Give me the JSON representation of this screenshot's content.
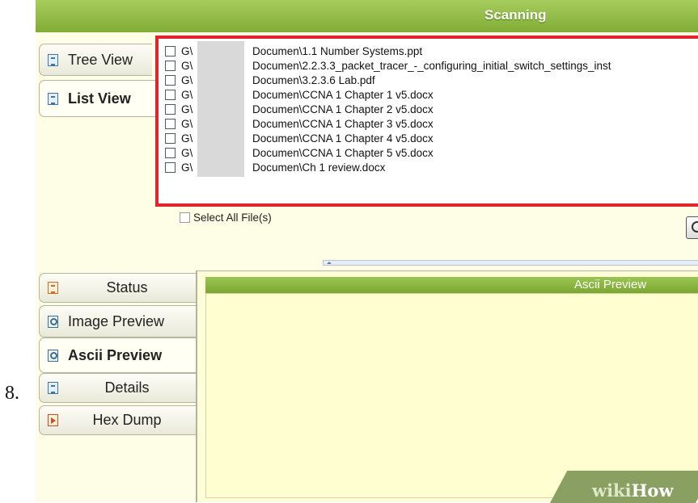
{
  "step_number": "8.",
  "header": {
    "title": "Scanning"
  },
  "view_tabs": [
    {
      "label": "Tree View",
      "icon": "tree-view-icon",
      "active": false
    },
    {
      "label": "List View",
      "icon": "list-view-icon",
      "active": true
    }
  ],
  "file_list": {
    "items": [
      {
        "drive": "G\\",
        "path": "Documen\\1.1 Number Systems.ppt"
      },
      {
        "drive": "G\\",
        "path": "Documen\\2.2.3.3_packet_tracer_-_configuring_initial_switch_settings_inst"
      },
      {
        "drive": "G\\",
        "path": "Documen\\3.2.3.6 Lab.pdf"
      },
      {
        "drive": "G\\",
        "path": "Documen\\CCNA 1 Chapter 1 v5.docx"
      },
      {
        "drive": "G\\",
        "path": "Documen\\CCNA 1 Chapter 2 v5.docx"
      },
      {
        "drive": "G\\",
        "path": "Documen\\CCNA 1 Chapter 3 v5.docx"
      },
      {
        "drive": "G\\",
        "path": "Documen\\CCNA 1 Chapter 4 v5.docx"
      },
      {
        "drive": "G\\",
        "path": "Documen\\CCNA 1 Chapter 5 v5.docx"
      },
      {
        "drive": "G\\",
        "path": "Documen\\Ch 1 review.docx"
      }
    ]
  },
  "select_all_label": "Select All File(s)",
  "preview_tabs": [
    {
      "label": "Status",
      "icon": "status-icon",
      "active": false
    },
    {
      "label": "Image Preview",
      "icon": "image-preview-icon",
      "active": false
    },
    {
      "label": "Ascii Preview",
      "icon": "ascii-preview-icon",
      "active": true
    },
    {
      "label": "Details",
      "icon": "details-icon",
      "active": false
    },
    {
      "label": "Hex Dump",
      "icon": "hex-dump-icon",
      "active": false
    }
  ],
  "preview_panel": {
    "title": "Ascii Preview"
  },
  "watermark": {
    "part1": "wiki",
    "part2": "How"
  },
  "colors": {
    "header_green": "#8ab83f",
    "highlight_red": "#e3242b",
    "panel_background": "#fefde6"
  }
}
